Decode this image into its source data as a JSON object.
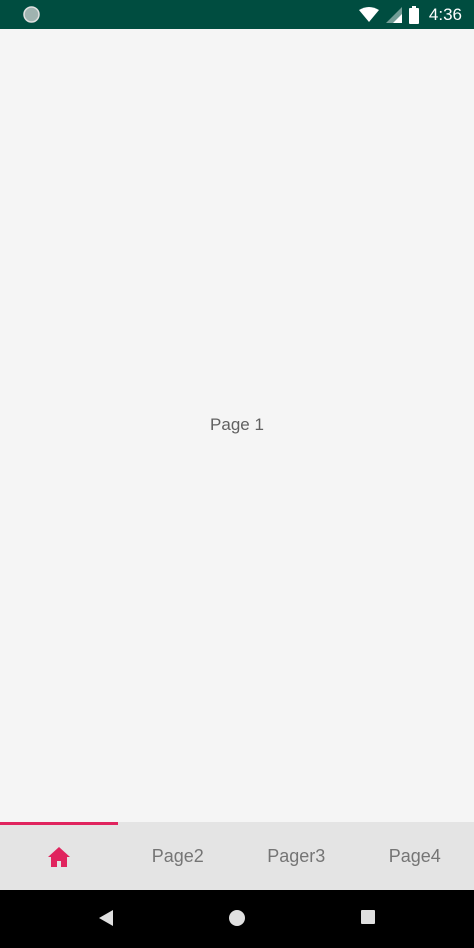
{
  "status_bar": {
    "time": "4:36",
    "icons": [
      "notification-dot-icon",
      "wifi-icon",
      "signal-icon",
      "battery-icon"
    ]
  },
  "content": {
    "page_label": "Page 1"
  },
  "tabs": [
    {
      "name": "home",
      "icon": "home-icon",
      "label": "",
      "selected": true
    },
    {
      "name": "page2",
      "label": "Page2",
      "selected": false
    },
    {
      "name": "pager3",
      "label": "Pager3",
      "selected": false
    },
    {
      "name": "page4",
      "label": "Page4",
      "selected": false
    }
  ],
  "colors": {
    "status_bar": "#004d40",
    "accent": "#e0245e",
    "tab_bar": "#e4e4e4",
    "background": "#f5f5f5"
  },
  "nav_bar": {
    "buttons": [
      "back-icon",
      "home-circle-icon",
      "recents-icon"
    ]
  }
}
